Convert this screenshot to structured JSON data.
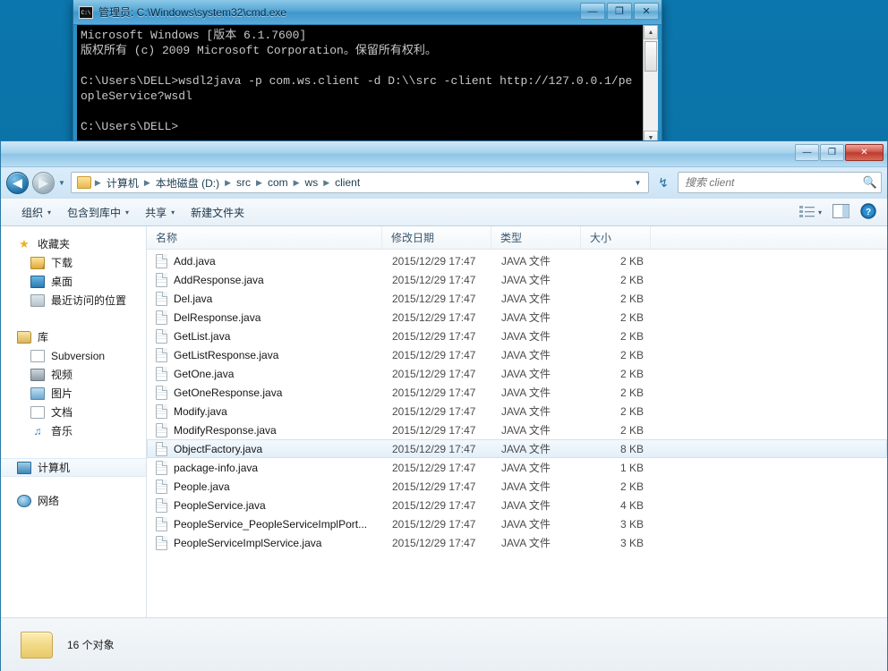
{
  "desktop": {
    "background_color": "#0a71a6"
  },
  "cmd_window": {
    "title": "管理员: C:\\Windows\\system32\\cmd.exe",
    "icon": "cmd-icon",
    "console_text": "Microsoft Windows [版本 6.1.7600]\n版权所有 (c) 2009 Microsoft Corporation。保留所有权利。\n\nC:\\Users\\DELL>wsdl2java -p com.ws.client -d D:\\\\src -client http://127.0.0.1/peopleService?wsdl\n\nC:\\Users\\DELL>",
    "buttons": {
      "minimize": "—",
      "maximize": "❐",
      "close": "✕"
    }
  },
  "explorer": {
    "buttons": {
      "minimize": "—",
      "restore": "❐",
      "close": "✕"
    },
    "nav": {
      "back": "◀",
      "forward": "▶",
      "history": "▼",
      "refresh": "↯"
    },
    "breadcrumb": {
      "separator": "▶",
      "items": [
        "计算机",
        "本地磁盘 (D:)",
        "src",
        "com",
        "ws",
        "client"
      ]
    },
    "search": {
      "placeholder": "搜索 client",
      "value": "",
      "icon": "search-icon"
    },
    "toolbar": {
      "organize": "组织",
      "include_in_library": "包含到库中",
      "share": "共享",
      "new_folder": "新建文件夹",
      "caret": "▾",
      "view_icon": "list-view-icon",
      "preview_icon": "preview-pane-icon",
      "help_icon": "help-icon",
      "help_glyph": "?"
    },
    "sidebar": {
      "favorites": {
        "label": "收藏夹",
        "items": [
          {
            "label": "下载",
            "icon": "downloads-icon"
          },
          {
            "label": "桌面",
            "icon": "desktop-icon"
          },
          {
            "label": "最近访问的位置",
            "icon": "recent-places-icon"
          }
        ]
      },
      "libraries": {
        "label": "库",
        "items": [
          {
            "label": "Subversion",
            "icon": "subversion-library-icon"
          },
          {
            "label": "视频",
            "icon": "videos-icon"
          },
          {
            "label": "图片",
            "icon": "pictures-icon"
          },
          {
            "label": "文档",
            "icon": "documents-icon"
          },
          {
            "label": "音乐",
            "icon": "music-icon"
          }
        ]
      },
      "computer": {
        "label": "计算机",
        "icon": "computer-icon",
        "selected": true
      },
      "network": {
        "label": "网络",
        "icon": "network-icon"
      }
    },
    "columns": {
      "name": "名称",
      "date": "修改日期",
      "type": "类型",
      "size": "大小"
    },
    "files": [
      {
        "name": "Add.java",
        "date": "2015/12/29 17:47",
        "type": "JAVA 文件",
        "size": "2 KB",
        "selected": false
      },
      {
        "name": "AddResponse.java",
        "date": "2015/12/29 17:47",
        "type": "JAVA 文件",
        "size": "2 KB",
        "selected": false
      },
      {
        "name": "Del.java",
        "date": "2015/12/29 17:47",
        "type": "JAVA 文件",
        "size": "2 KB",
        "selected": false
      },
      {
        "name": "DelResponse.java",
        "date": "2015/12/29 17:47",
        "type": "JAVA 文件",
        "size": "2 KB",
        "selected": false
      },
      {
        "name": "GetList.java",
        "date": "2015/12/29 17:47",
        "type": "JAVA 文件",
        "size": "2 KB",
        "selected": false
      },
      {
        "name": "GetListResponse.java",
        "date": "2015/12/29 17:47",
        "type": "JAVA 文件",
        "size": "2 KB",
        "selected": false
      },
      {
        "name": "GetOne.java",
        "date": "2015/12/29 17:47",
        "type": "JAVA 文件",
        "size": "2 KB",
        "selected": false
      },
      {
        "name": "GetOneResponse.java",
        "date": "2015/12/29 17:47",
        "type": "JAVA 文件",
        "size": "2 KB",
        "selected": false
      },
      {
        "name": "Modify.java",
        "date": "2015/12/29 17:47",
        "type": "JAVA 文件",
        "size": "2 KB",
        "selected": false
      },
      {
        "name": "ModifyResponse.java",
        "date": "2015/12/29 17:47",
        "type": "JAVA 文件",
        "size": "2 KB",
        "selected": false
      },
      {
        "name": "ObjectFactory.java",
        "date": "2015/12/29 17:47",
        "type": "JAVA 文件",
        "size": "8 KB",
        "selected": true
      },
      {
        "name": "package-info.java",
        "date": "2015/12/29 17:47",
        "type": "JAVA 文件",
        "size": "1 KB",
        "selected": false
      },
      {
        "name": "People.java",
        "date": "2015/12/29 17:47",
        "type": "JAVA 文件",
        "size": "2 KB",
        "selected": false
      },
      {
        "name": "PeopleService.java",
        "date": "2015/12/29 17:47",
        "type": "JAVA 文件",
        "size": "4 KB",
        "selected": false
      },
      {
        "name": "PeopleService_PeopleServiceImplPort...",
        "date": "2015/12/29 17:47",
        "type": "JAVA 文件",
        "size": "3 KB",
        "selected": false
      },
      {
        "name": "PeopleServiceImplService.java",
        "date": "2015/12/29 17:47",
        "type": "JAVA 文件",
        "size": "3 KB",
        "selected": false
      }
    ],
    "statusbar": {
      "text": "16 个对象",
      "icon": "folder-icon"
    }
  }
}
